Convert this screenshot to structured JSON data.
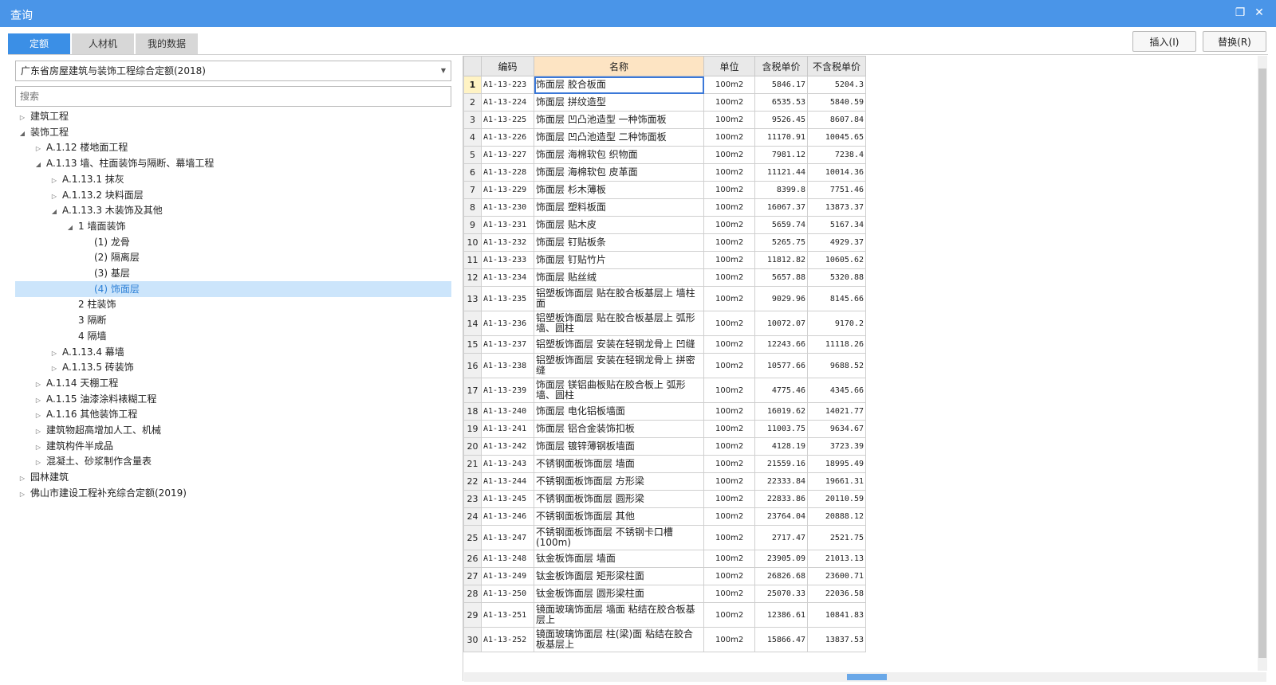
{
  "window": {
    "title": "查询"
  },
  "tabs": [
    {
      "label": "定额"
    },
    {
      "label": "人材机"
    },
    {
      "label": "我的数据"
    }
  ],
  "toolbar": {
    "insert_label": "插入(I)",
    "replace_label": "替换(R)"
  },
  "left": {
    "dropdown_value": "广东省房屋建筑与装饰工程综合定额(2018)",
    "search_placeholder": "搜索",
    "tree": [
      {
        "label": "建筑工程",
        "level": 0,
        "toggle": "collapsed"
      },
      {
        "label": "装饰工程",
        "level": 0,
        "toggle": "expanded"
      },
      {
        "label": "A.1.12 楼地面工程",
        "level": 1,
        "toggle": "collapsed"
      },
      {
        "label": "A.1.13 墙、柱面装饰与隔断、幕墙工程",
        "level": 1,
        "toggle": "expanded"
      },
      {
        "label": "A.1.13.1 抹灰",
        "level": 2,
        "toggle": "collapsed"
      },
      {
        "label": "A.1.13.2 块料面层",
        "level": 2,
        "toggle": "collapsed"
      },
      {
        "label": "A.1.13.3 木装饰及其他",
        "level": 2,
        "toggle": "expanded"
      },
      {
        "label": "1 墙面装饰",
        "level": 3,
        "toggle": "expanded"
      },
      {
        "label": "(1) 龙骨",
        "level": 4,
        "toggle": "none"
      },
      {
        "label": "(2) 隔离层",
        "level": 4,
        "toggle": "none"
      },
      {
        "label": "(3) 基层",
        "level": 4,
        "toggle": "none"
      },
      {
        "label": "(4) 饰面层",
        "level": 4,
        "toggle": "none",
        "selected": true
      },
      {
        "label": "2 柱装饰",
        "level": 3,
        "toggle": "none"
      },
      {
        "label": "3 隔断",
        "level": 3,
        "toggle": "none"
      },
      {
        "label": "4 隔墙",
        "level": 3,
        "toggle": "none"
      },
      {
        "label": "A.1.13.4 幕墙",
        "level": 2,
        "toggle": "collapsed"
      },
      {
        "label": "A.1.13.5 砖装饰",
        "level": 2,
        "toggle": "collapsed"
      },
      {
        "label": "A.1.14 天棚工程",
        "level": 1,
        "toggle": "collapsed"
      },
      {
        "label": "A.1.15 油漆涂料裱糊工程",
        "level": 1,
        "toggle": "collapsed"
      },
      {
        "label": "A.1.16 其他装饰工程",
        "level": 1,
        "toggle": "collapsed"
      },
      {
        "label": "建筑物超高增加人工、机械",
        "level": 1,
        "toggle": "collapsed"
      },
      {
        "label": "建筑构件半成品",
        "level": 1,
        "toggle": "collapsed"
      },
      {
        "label": "混凝土、砂浆制作含量表",
        "level": 1,
        "toggle": "collapsed"
      },
      {
        "label": "园林建筑",
        "level": 0,
        "toggle": "collapsed"
      },
      {
        "label": "佛山市建设工程补充综合定额(2019)",
        "level": 0,
        "toggle": "collapsed"
      }
    ]
  },
  "grid": {
    "headers": [
      "编码",
      "名称",
      "单位",
      "含税单价",
      "不含税单价"
    ],
    "rows": [
      {
        "n": "1",
        "code": "A1-13-223",
        "name": "饰面层 胶合板面",
        "unit": "100m2",
        "tax": "5846.17",
        "notax": "5204.3"
      },
      {
        "n": "2",
        "code": "A1-13-224",
        "name": "饰面层 拼纹造型",
        "unit": "100m2",
        "tax": "6535.53",
        "notax": "5840.59"
      },
      {
        "n": "3",
        "code": "A1-13-225",
        "name": "饰面层 凹凸池造型 一种饰面板",
        "unit": "100m2",
        "tax": "9526.45",
        "notax": "8607.84"
      },
      {
        "n": "4",
        "code": "A1-13-226",
        "name": "饰面层 凹凸池造型 二种饰面板",
        "unit": "100m2",
        "tax": "11170.91",
        "notax": "10045.65"
      },
      {
        "n": "5",
        "code": "A1-13-227",
        "name": "饰面层 海棉软包 织物面",
        "unit": "100m2",
        "tax": "7981.12",
        "notax": "7238.4"
      },
      {
        "n": "6",
        "code": "A1-13-228",
        "name": "饰面层 海棉软包 皮革面",
        "unit": "100m2",
        "tax": "11121.44",
        "notax": "10014.36"
      },
      {
        "n": "7",
        "code": "A1-13-229",
        "name": "饰面层 杉木薄板",
        "unit": "100m2",
        "tax": "8399.8",
        "notax": "7751.46"
      },
      {
        "n": "8",
        "code": "A1-13-230",
        "name": "饰面层 塑料板面",
        "unit": "100m2",
        "tax": "16067.37",
        "notax": "13873.37"
      },
      {
        "n": "9",
        "code": "A1-13-231",
        "name": "饰面层 贴木皮",
        "unit": "100m2",
        "tax": "5659.74",
        "notax": "5167.34"
      },
      {
        "n": "10",
        "code": "A1-13-232",
        "name": "饰面层 钉贴板条",
        "unit": "100m2",
        "tax": "5265.75",
        "notax": "4929.37"
      },
      {
        "n": "11",
        "code": "A1-13-233",
        "name": "饰面层 钉贴竹片",
        "unit": "100m2",
        "tax": "11812.82",
        "notax": "10605.62"
      },
      {
        "n": "12",
        "code": "A1-13-234",
        "name": "饰面层 贴丝绒",
        "unit": "100m2",
        "tax": "5657.88",
        "notax": "5320.88"
      },
      {
        "n": "13",
        "code": "A1-13-235",
        "name": "铝塑板饰面层 贴在胶合板基层上 墙柱面",
        "unit": "100m2",
        "tax": "9029.96",
        "notax": "8145.66"
      },
      {
        "n": "14",
        "code": "A1-13-236",
        "name": "铝塑板饰面层 贴在胶合板基层上 弧形墙、圆柱",
        "unit": "100m2",
        "tax": "10072.07",
        "notax": "9170.2"
      },
      {
        "n": "15",
        "code": "A1-13-237",
        "name": "铝塑板饰面层 安装在轻钢龙骨上 凹缝",
        "unit": "100m2",
        "tax": "12243.66",
        "notax": "11118.26"
      },
      {
        "n": "16",
        "code": "A1-13-238",
        "name": "铝塑板饰面层 安装在轻钢龙骨上 拼密缝",
        "unit": "100m2",
        "tax": "10577.66",
        "notax": "9688.52"
      },
      {
        "n": "17",
        "code": "A1-13-239",
        "name": "饰面层 镁铝曲板贴在胶合板上 弧形墙、圆柱",
        "unit": "100m2",
        "tax": "4775.46",
        "notax": "4345.66"
      },
      {
        "n": "18",
        "code": "A1-13-240",
        "name": "饰面层 电化铝板墙面",
        "unit": "100m2",
        "tax": "16019.62",
        "notax": "14021.77"
      },
      {
        "n": "19",
        "code": "A1-13-241",
        "name": "饰面层 铝合金装饰扣板",
        "unit": "100m2",
        "tax": "11003.75",
        "notax": "9634.67"
      },
      {
        "n": "20",
        "code": "A1-13-242",
        "name": "饰面层 镀锌薄钢板墙面",
        "unit": "100m2",
        "tax": "4128.19",
        "notax": "3723.39"
      },
      {
        "n": "21",
        "code": "A1-13-243",
        "name": "不锈钢面板饰面层 墙面",
        "unit": "100m2",
        "tax": "21559.16",
        "notax": "18995.49"
      },
      {
        "n": "22",
        "code": "A1-13-244",
        "name": "不锈钢面板饰面层 方形梁",
        "unit": "100m2",
        "tax": "22333.84",
        "notax": "19661.31"
      },
      {
        "n": "23",
        "code": "A1-13-245",
        "name": "不锈钢面板饰面层 圆形梁",
        "unit": "100m2",
        "tax": "22833.86",
        "notax": "20110.59"
      },
      {
        "n": "24",
        "code": "A1-13-246",
        "name": "不锈钢面板饰面层 其他",
        "unit": "100m2",
        "tax": "23764.04",
        "notax": "20888.12"
      },
      {
        "n": "25",
        "code": "A1-13-247",
        "name": "不锈钢面板饰面层 不锈钢卡口槽(100m)",
        "unit": "100m2",
        "tax": "2717.47",
        "notax": "2521.75"
      },
      {
        "n": "26",
        "code": "A1-13-248",
        "name": "钛金板饰面层 墙面",
        "unit": "100m2",
        "tax": "23905.09",
        "notax": "21013.13"
      },
      {
        "n": "27",
        "code": "A1-13-249",
        "name": "钛金板饰面层 矩形梁柱面",
        "unit": "100m2",
        "tax": "26826.68",
        "notax": "23600.71"
      },
      {
        "n": "28",
        "code": "A1-13-250",
        "name": "钛金板饰面层 圆形梁柱面",
        "unit": "100m2",
        "tax": "25070.33",
        "notax": "22036.58"
      },
      {
        "n": "29",
        "code": "A1-13-251",
        "name": "镜面玻璃饰面层 墙面 粘结在胶合板基层上",
        "unit": "100m2",
        "tax": "12386.61",
        "notax": "10841.83"
      },
      {
        "n": "30",
        "code": "A1-13-252",
        "name": "镜面玻璃饰面层 柱(梁)面 粘结在胶合板基层上",
        "unit": "100m2",
        "tax": "15866.47",
        "notax": "13837.53"
      }
    ]
  }
}
